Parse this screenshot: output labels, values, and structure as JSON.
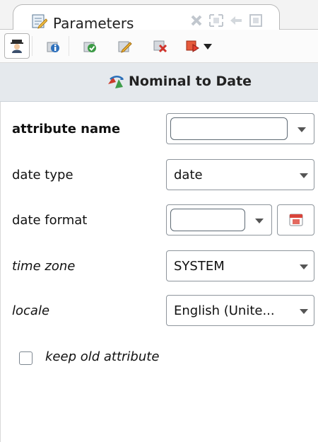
{
  "tab": {
    "title": "Parameters"
  },
  "toolbar": {
    "icons": [
      "expert-mode-icon",
      "info-icon",
      "validate-icon",
      "edit-icon",
      "delete-icon",
      "breakpoint-icon",
      "dropdown-arrow-icon"
    ]
  },
  "operator": {
    "title": "Nominal to Date"
  },
  "parameters": [
    {
      "label": "attribute name",
      "value": ""
    },
    {
      "label": "date type",
      "value": "date"
    },
    {
      "label": "date format",
      "value": ""
    },
    {
      "label": "time zone",
      "value": "SYSTEM"
    },
    {
      "label": "locale",
      "value": "English (Unite..."
    }
  ],
  "checkbox": {
    "label": "keep old attribute",
    "checked": false
  },
  "colors": {
    "header_bg": "#e5e9ed",
    "accent_red": "#d94b2b",
    "accent_green": "#3b9a45",
    "accent_blue": "#2b6fb8"
  }
}
